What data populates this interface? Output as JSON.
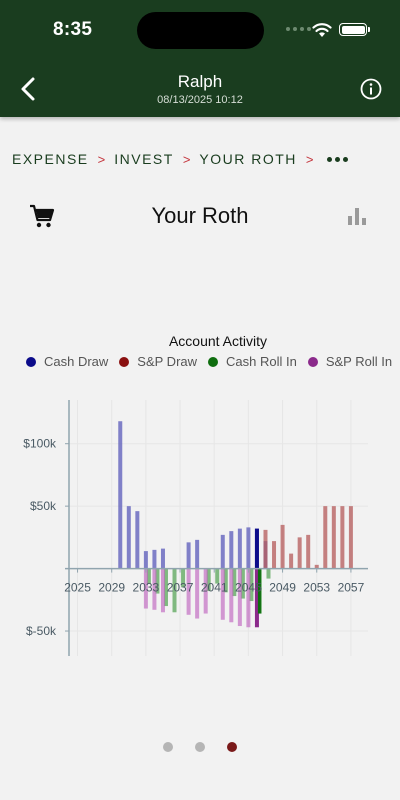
{
  "status": {
    "time": "8:35"
  },
  "header": {
    "title": "Ralph",
    "subtitle": "08/13/2025 10:12"
  },
  "breadcrumb": {
    "items": [
      "EXPENSE",
      "INVEST",
      "YOUR ROTH"
    ],
    "separator": ">"
  },
  "page": {
    "title": "Your Roth"
  },
  "colors": {
    "header": "#1a3d1f",
    "cash_draw": "#0b0b8a",
    "sp_draw": "#8a1010",
    "cash_roll_in": "#0f6e0f",
    "sp_roll_in": "#8b2a8b",
    "pager_active": "#7a1a1a",
    "pager_inactive": "#b5b5b5"
  },
  "icons": {
    "back": "chevron-left-icon",
    "info": "info-circle-icon",
    "cart": "shopping-cart-icon",
    "chart": "bar-chart-icon"
  },
  "pager": {
    "count": 3,
    "active": 2
  },
  "chart_data": {
    "type": "bar",
    "title": "Account Activity",
    "xlabel": "",
    "ylabel": "",
    "legend_position": "top",
    "grid": true,
    "ylim": [
      -70000,
      135000
    ],
    "xlim": [
      2024,
      2059
    ],
    "x_ticks": [
      "2025",
      "2029",
      "2033",
      "2037",
      "2041",
      "2045",
      "2049",
      "2053",
      "2057"
    ],
    "y_ticks": [
      {
        "value": 100000,
        "label": "$100k"
      },
      {
        "value": 50000,
        "label": "$50k"
      },
      {
        "value": -50000,
        "label": "$-50k"
      }
    ],
    "legend": [
      "Cash Draw",
      "S&P Draw",
      "Cash Roll In",
      "S&P Roll In"
    ],
    "series": [
      {
        "name": "Cash Draw",
        "x": [
          2030,
          2031,
          2032,
          2033,
          2034,
          2035,
          2038,
          2039,
          2042,
          2043,
          2044,
          2045,
          2046,
          2047
        ],
        "values": [
          118000,
          50000,
          46000,
          14000,
          15000,
          16000,
          21000,
          23000,
          27000,
          30000,
          32000,
          33000,
          32000,
          22000
        ]
      },
      {
        "name": "S&P Draw",
        "x": [
          2047,
          2048,
          2049,
          2050,
          2051,
          2052,
          2053,
          2054,
          2055,
          2056,
          2057
        ],
        "values": [
          31000,
          22000,
          35000,
          12000,
          25000,
          27000,
          3000,
          50000,
          50000,
          50000,
          50000
        ]
      },
      {
        "name": "Cash Roll In",
        "x": [
          2033,
          2034,
          2035,
          2036,
          2037,
          2040,
          2041,
          2042,
          2043,
          2044,
          2045,
          2046,
          2047
        ],
        "values": [
          -12000,
          -20000,
          -30000,
          -35000,
          -15000,
          -18000,
          -12000,
          -19000,
          -22000,
          -24000,
          -26000,
          -36000,
          -8000
        ]
      },
      {
        "name": "S&P Roll In",
        "x": [
          2033,
          2034,
          2035,
          2038,
          2039,
          2040,
          2042,
          2043,
          2044,
          2045,
          2046
        ],
        "values": [
          -32000,
          -33000,
          -35000,
          -37000,
          -40000,
          -36000,
          -41000,
          -43000,
          -46000,
          -47000,
          -25000
        ]
      }
    ]
  }
}
